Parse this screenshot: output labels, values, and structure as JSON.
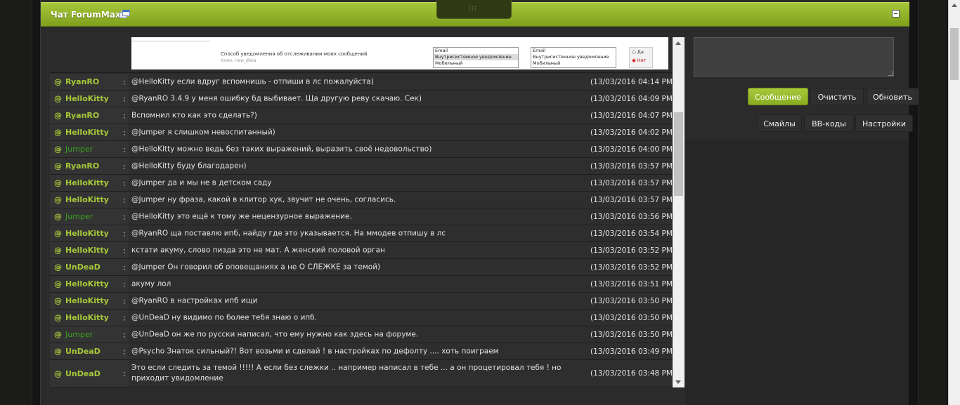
{
  "header": {
    "title": "Чат ForumMaxi",
    "handle_label": "⁝⁝⁝"
  },
  "embedded_screenshot": {
    "label": "Способ уведомления об отслеживании моих сообщений",
    "sublabel": "Ключ: new_dkea",
    "listbox1": [
      "Email",
      "Внутрисистемное уведомление",
      "Мобильный"
    ],
    "listbox2": [
      "Email",
      "Внутрисистемное уведомление",
      "Мобильный"
    ],
    "radio_yes": "Да",
    "radio_no": "Нет"
  },
  "messages": [
    {
      "at": "@",
      "nick": "RyanRO",
      "text": "@HelloKitty если вдруг вспомнишь - отпиши в лс пожалуйста)",
      "time": "(13/03/2016 04:14 PM)"
    },
    {
      "at": "@",
      "nick": "HelloKitty",
      "text": "@RyanRO 3.4.9 у меня ошибку бд выбивает. Ща другую реву скачаю. Сек)",
      "time": "(13/03/2016 04:09 PM)"
    },
    {
      "at": "@",
      "nick": "RyanRO",
      "text": "Вспомнил кто как это сделать?)",
      "time": "(13/03/2016 04:07 PM)"
    },
    {
      "at": "@",
      "nick": "HelloKitty",
      "text": "@Jumper я слишком невоспитанный)",
      "time": "(13/03/2016 04:02 PM)"
    },
    {
      "at": "@",
      "nick": "Jumper",
      "text": "@HelloKitty можно ведь без таких выражений, выразить своё недовольство)",
      "time": "(13/03/2016 04:00 PM)"
    },
    {
      "at": "@",
      "nick": "RyanRO",
      "text": "@HelloKitty буду благодарен)",
      "time": "(13/03/2016 03:57 PM)"
    },
    {
      "at": "@",
      "nick": "HelloKitty",
      "text": "@Jumper да и мы не в детском саду",
      "time": "(13/03/2016 03:57 PM)"
    },
    {
      "at": "@",
      "nick": "HelloKitty",
      "text": "@Jumper ну фраза, какой в клитор хук, звучит не очень, согласись.",
      "time": "(13/03/2016 03:57 PM)"
    },
    {
      "at": "@",
      "nick": "Jumper",
      "text": "@HelloKitty это ещё к тому же нецензурное выражение.",
      "time": "(13/03/2016 03:56 PM)"
    },
    {
      "at": "@",
      "nick": "HelloKitty",
      "text": "@RyanRO ща поставлю ипб, найду где это указывается. На ммодев отпишу в лс",
      "time": "(13/03/2016 03:54 PM)"
    },
    {
      "at": "@",
      "nick": "HelloKitty",
      "text": "кстати акуму, слово пизда это не мат. А женский половой орган",
      "time": "(13/03/2016 03:52 PM)"
    },
    {
      "at": "@",
      "nick": "UnDeaD",
      "text": "@Jumper Он говорил об оповещаниях а не О СЛЕЖКЕ за темой)",
      "time": "(13/03/2016 03:52 PM)"
    },
    {
      "at": "@",
      "nick": "HelloKitty",
      "text": "акуму лол",
      "time": "(13/03/2016 03:51 PM)"
    },
    {
      "at": "@",
      "nick": "HelloKitty",
      "text": "@RyanRO в настройках ипб ищи",
      "time": "(13/03/2016 03:50 PM)"
    },
    {
      "at": "@",
      "nick": "HelloKitty",
      "text": "@UnDeaD ну видимо по более тебя знаю о ипб.",
      "time": "(13/03/2016 03:50 PM)"
    },
    {
      "at": "@",
      "nick": "Jumper",
      "text": "@UnDeaD он же по русски написал, что ему нужно как здесь на форуме.",
      "time": "(13/03/2016 03:50 PM)"
    },
    {
      "at": "@",
      "nick": "UnDeaD",
      "text": "@Psycho Знаток сильный?! Вот возьми и сделай ! в настройках по дефолту .... хоть поиграем",
      "time": "(13/03/2016 03:49 PM)"
    },
    {
      "at": "@",
      "nick": "UnDeaD",
      "text": "Это если следить за темой !!!!! А если без слежки .. например написал в тебе ... а он процетировал тебя ! но приходит увидомление",
      "time": "(13/03/2016 03:48 PM)"
    }
  ],
  "buttons": {
    "send": "Сообщение",
    "clear": "Очистить",
    "refresh": "Обновить",
    "smilies": "Смайлы",
    "bbcodes": "BB-коды",
    "settings": "Настройки"
  },
  "colors": {
    "accent": "#a8c93a",
    "jumper_nick": "#3aa321",
    "background": "#2b2b2b"
  }
}
